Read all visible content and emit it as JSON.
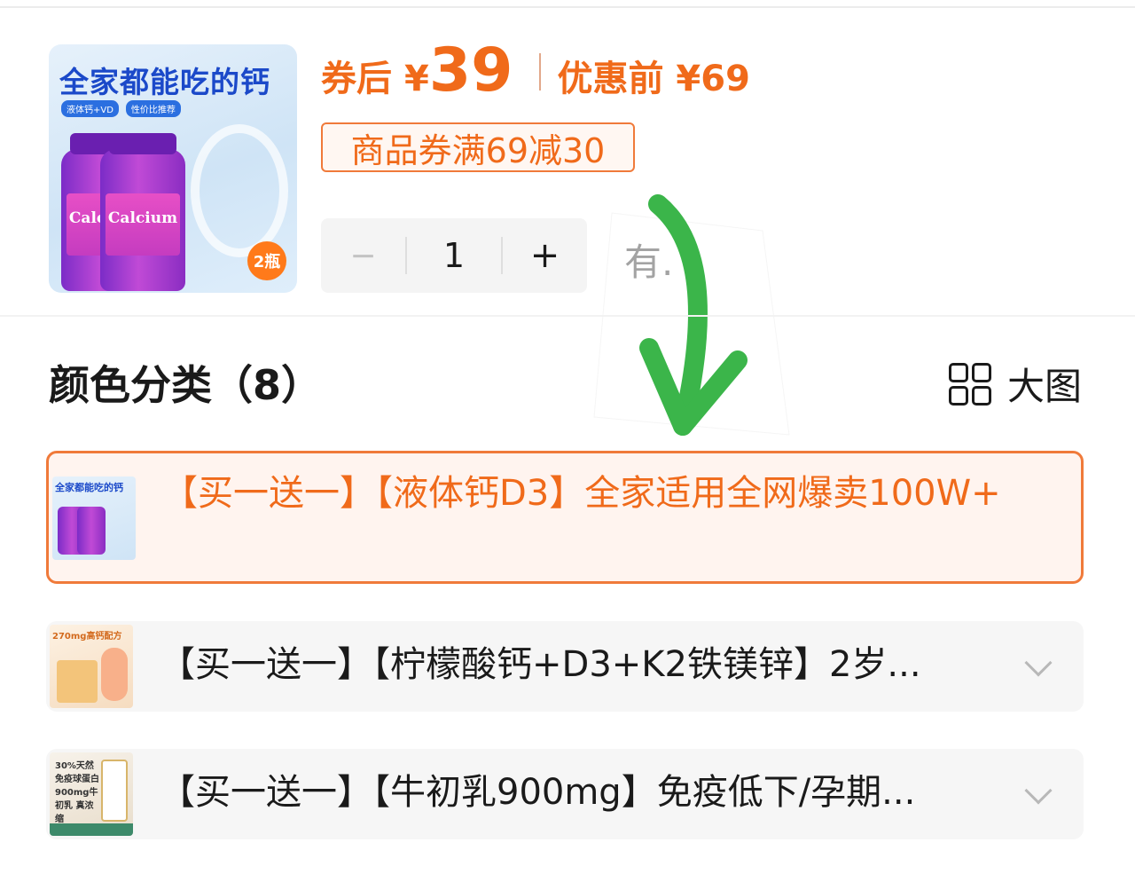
{
  "product": {
    "thumb_title": "全家都能吃的钙",
    "thumb_tags": [
      "液体钙+VD",
      "性价比推荐"
    ],
    "thumb_bottle_text": "Calcium",
    "thumb_badge": "2瓶"
  },
  "price": {
    "after_coupon_label": "券后",
    "currency": "¥",
    "after_coupon_amount": "39",
    "before_label": "优惠前 ¥69"
  },
  "coupon": {
    "text": "商品券满69减30"
  },
  "quantity": {
    "minus": "−",
    "value": "1",
    "plus": "+"
  },
  "stock": {
    "text": "有."
  },
  "section": {
    "title": "颜色分类（8）",
    "view_toggle_label": "大图"
  },
  "variants": [
    {
      "label": "【买一送一】【液体钙D3】全家适用全网爆卖100W+",
      "thumb_text": "全家都能吃的钙",
      "selected": true
    },
    {
      "label": "【买一送一】【柠檬酸钙+D3+K2铁镁锌】2岁...",
      "thumb_text": "270mg高钙配方",
      "selected": false
    },
    {
      "label": "【买一送一】【牛初乳900mg】免疫低下/孕期...",
      "thumb_text": "30%天然免疫球蛋白 900mg牛初乳 真浓缩",
      "selected": false
    }
  ],
  "colors": {
    "accent": "#f06a1a",
    "selected_bg": "#fff4ef",
    "arrow": "#3bb54a"
  }
}
